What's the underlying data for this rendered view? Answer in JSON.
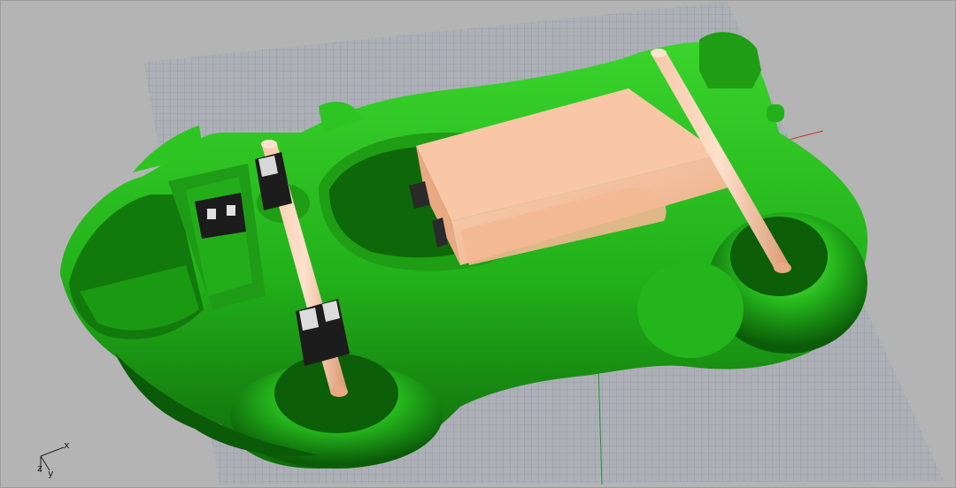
{
  "viewport": {
    "type": "3D perspective viewport",
    "background_color": "#b4b4b4",
    "grid_color": "#8a8f99",
    "grid_shown": true,
    "x_axis_color": "#c0392b",
    "y_axis_color": "#2e8b3e",
    "model_colors": {
      "body": "#22b11a",
      "body_shadow": "#0f6a0a",
      "component": "#f3b894",
      "hardware": "#1c1c1c"
    },
    "axis_widget": {
      "x_label": "x",
      "y_label": "y",
      "z_label": "z"
    }
  }
}
